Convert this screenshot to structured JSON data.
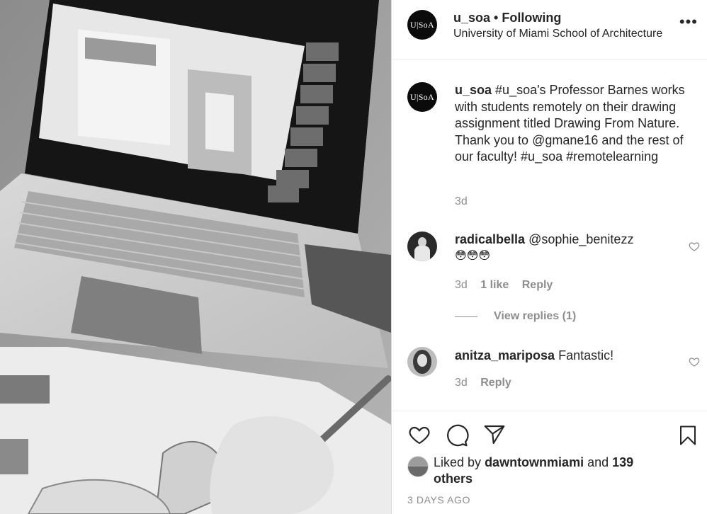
{
  "header": {
    "avatar_text": "U|SoA",
    "username": "u_soa",
    "separator": "•",
    "follow_status": "Following",
    "subtitle": "University of Miami School of Architecture",
    "more_icon": "more-horizontal-icon"
  },
  "caption": {
    "avatar_text": "U|SoA",
    "username": "u_soa",
    "text": "#u_soa's Professor Barnes works with students remotely on their drawing assignment titled Drawing From Nature. Thank you to @gmane16 and the rest of our faculty! #u_soa #remotelearning",
    "time": "3d"
  },
  "comments": [
    {
      "username": "radicalbella",
      "text": "@sophie_benitezz",
      "emoji": "😳😳😳",
      "time": "3d",
      "likes": "1 like",
      "reply": "Reply",
      "view_replies": "View replies (1)"
    },
    {
      "username": "anitza_mariposa",
      "text": "Fantastic!",
      "time": "3d",
      "reply": "Reply"
    }
  ],
  "likes": {
    "prefix": "Liked by",
    "user": "dawntownmiami",
    "and": "and",
    "others": "139 others"
  },
  "date": "3 DAYS AGO"
}
